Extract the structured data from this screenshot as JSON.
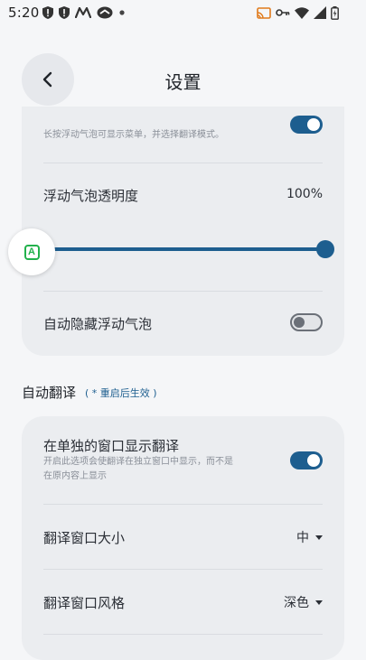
{
  "status_bar": {
    "time": "5:20",
    "left_icons": [
      "shield-alert-icon",
      "shield-alert-icon",
      "m-logo-icon",
      "app-badge-icon",
      "dot-icon"
    ],
    "right_icons": [
      "cast-icon",
      "key-icon",
      "wifi-icon",
      "signal-icon",
      "battery-icon"
    ]
  },
  "header": {
    "title": "设置",
    "back_icon": "chevron-left-icon"
  },
  "bubble_group": {
    "long_press_desc": "长按浮动气泡可显示菜单，并选择翻译模式。",
    "long_press_toggle_on": true,
    "opacity_label": "浮动气泡透明度",
    "opacity_value_text": "100%",
    "opacity_fraction": 1.0,
    "auto_hide_label": "自动隐藏浮动气泡",
    "auto_hide_on": false,
    "floating_bubble_letter": "A"
  },
  "auto_translate": {
    "title": "自动翻译",
    "note": "( * 重启后生效 )",
    "separate_window_label": "在单独的窗口显示翻译",
    "separate_window_desc_line1": "开启此选项会使翻译在独立窗口中显示，而不是",
    "separate_window_desc_line2": "在原内容上显示",
    "separate_window_on": true,
    "window_size_label": "翻译窗口大小",
    "window_size_value": "中",
    "window_style_label": "翻译窗口风格",
    "window_style_value": "深色"
  },
  "colors": {
    "accent": "#1d5e8f",
    "bubble_accent": "#22b14c",
    "card_bg": "#ebedf0",
    "page_bg": "#f5f6f8"
  }
}
